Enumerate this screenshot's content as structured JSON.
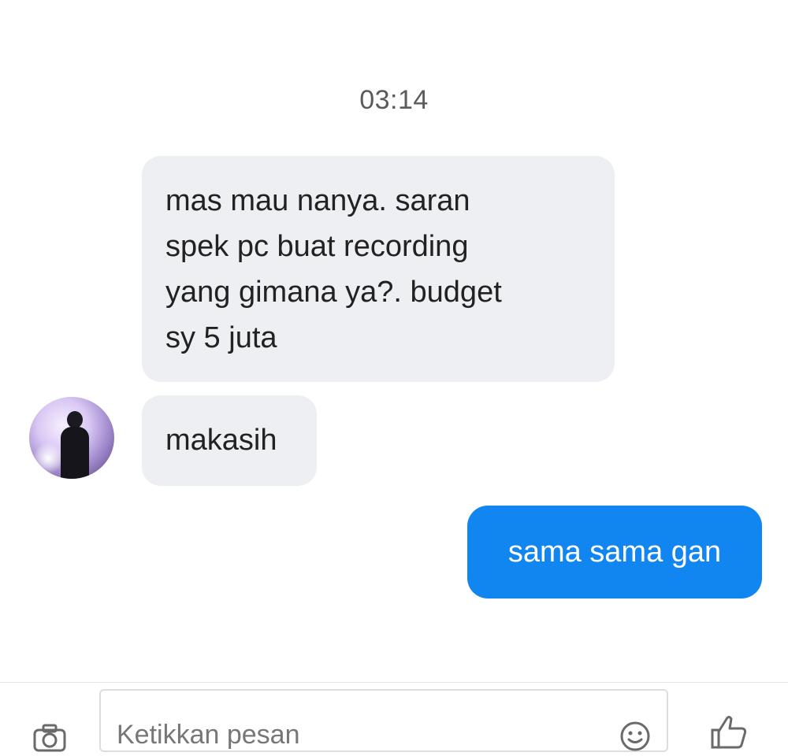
{
  "conversation": {
    "timestamp": "03:14",
    "incoming_first_lines": [
      "mas mau nanya. saran",
      "spek pc buat recording",
      "yang gimana ya?. budget",
      "sy 5 juta"
    ],
    "incoming_second": "makasih",
    "outgoing": "sama sama gan"
  },
  "composer": {
    "placeholder": "Ketikkan pesan"
  },
  "icons": {
    "camera": "camera-icon",
    "emoji": "emoji-icon",
    "like": "thumbs-up-icon",
    "avatar": "contact-avatar"
  },
  "colors": {
    "incoming_bubble": "#eeeff2",
    "outgoing_bubble": "#1286f0",
    "timestamp_text": "#5b5b5b"
  }
}
